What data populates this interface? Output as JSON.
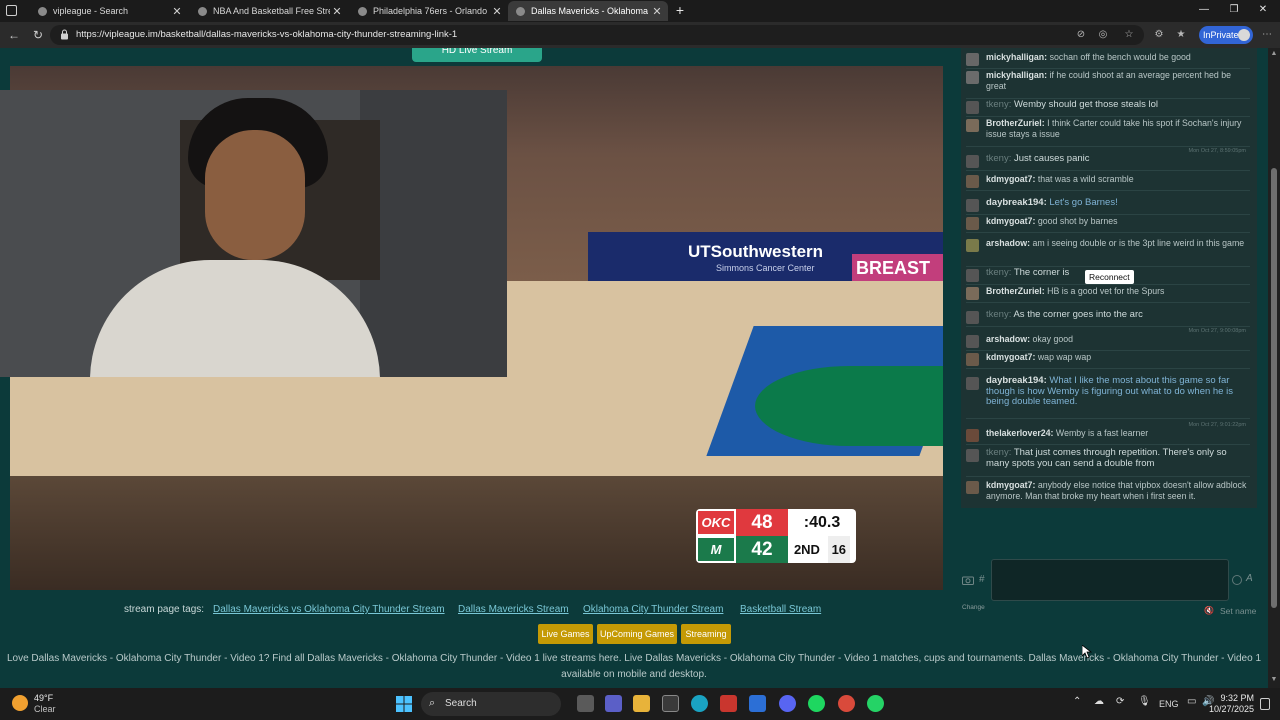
{
  "browser": {
    "tabs": [
      {
        "label": "vipleague - Search",
        "active": false
      },
      {
        "label": "NBA And Basketball Free Streams",
        "active": false
      },
      {
        "label": "Philadelphia 76ers - Orlando",
        "active": false
      },
      {
        "label": "Dallas Mavericks - Oklahoma",
        "active": true
      }
    ],
    "new_tab_label": "+",
    "url": "https://vipleague.im/basketball/dallas-mavericks-vs-oklahoma-city-thunder-streaming-link-1",
    "inprivate_label": "InPrivate"
  },
  "page": {
    "hd_button": "HD Live Stream",
    "video": {
      "banner_sponsor": "UTSouthwestern",
      "banner_sub": "Simmons Cancer Center",
      "banner_right": "BREAST HE",
      "scoreboard": {
        "team1_abbr": "OKC",
        "team1_score": "48",
        "clock": ":40.3",
        "team2_abbr": "M",
        "team2_score": "42",
        "period": "2ND",
        "shot_clock": "16"
      }
    },
    "tags_label": "stream page tags:",
    "tags": [
      "Dallas Mavericks vs Oklahoma City Thunder Stream",
      "Dallas Mavericks Stream",
      "Oklahoma City Thunder Stream",
      "Basketball Stream"
    ],
    "nav_buttons": [
      "Live Games",
      "UpComing Games",
      "Streaming"
    ],
    "footer_line1": "Love Dallas Mavericks - Oklahoma City Thunder - Video 1? Find all Dallas Mavericks - Oklahoma City Thunder - Video 1 live streams here. Live Dallas Mavericks - Oklahoma City Thunder - Video 1 matches, cups and tournaments. Dallas Mavericks - Oklahoma City Thunder - Video 1",
    "footer_line2": "available on mobile and desktop."
  },
  "chat": {
    "messages": [
      {
        "user": "mickyhalligan:",
        "text": "sochan off the bench would be good",
        "dim": false,
        "hl": false
      },
      {
        "user": "mickyhalligan:",
        "text": "if he could shoot at an average percent hed be great",
        "dim": false,
        "hl": false
      },
      {
        "user": "tkeny:",
        "text": "Wemby should get those steals lol",
        "dim": true,
        "hl": true
      },
      {
        "user": "BrotherZuriel:",
        "text": "I think Carter could take his spot if Sochan's injury issue stays a issue",
        "dim": false,
        "hl": false
      },
      {
        "user": "tkeny:",
        "text": "Just causes panic",
        "dim": true,
        "hl": true,
        "stamp": "Mon Oct 27, 8:59:05pm"
      },
      {
        "user": "kdmygoat7:",
        "text": "that was a wild scramble",
        "dim": false,
        "hl": false
      },
      {
        "user": "daybreak194:",
        "text": "Let's go Barnes!",
        "dim": false,
        "hl": true
      },
      {
        "user": "kdmygoat7:",
        "text": "good shot by barnes",
        "dim": false,
        "hl": false
      },
      {
        "user": "arshadow:",
        "text": "am i seeing double or is the 3pt line weird in this game",
        "dim": false,
        "hl": false
      },
      {
        "user": "tkeny:",
        "text": "The corner is",
        "dim": true,
        "hl": true
      },
      {
        "user": "BrotherZuriel:",
        "text": "HB is a good vet for the Spurs",
        "dim": false,
        "hl": false
      },
      {
        "user": "tkeny:",
        "text": "As the corner goes into the arc",
        "dim": true,
        "hl": true
      },
      {
        "user": "arshadow:",
        "text": "okay good",
        "dim": false,
        "hl": false,
        "stamp": "Mon Oct 27, 9:00:08pm"
      },
      {
        "user": "kdmygoat7:",
        "text": "wap wap wap",
        "dim": false,
        "hl": false
      },
      {
        "user": "daybreak194:",
        "text": "What I like the most about this game so far though is how Wemby is figuring out what to do when he is being double teamed.",
        "dim": false,
        "hl": true
      },
      {
        "user": "thelakerlover24:",
        "text": "Wemby is a fast learner",
        "dim": false,
        "hl": false,
        "stamp": "Mon Oct 27, 9:01:22pm"
      },
      {
        "user": "tkeny:",
        "text": "That just comes through repetition. There's only so many spots you can send a double from",
        "dim": true,
        "hl": true
      },
      {
        "user": "kdmygoat7:",
        "text": "anybody else notice that vipbox doesn't allow adblock anymore. Man that broke my heart when i first seen it.",
        "dim": false,
        "hl": false
      }
    ],
    "reconnect_label": "Reconnect",
    "hash_label": "#",
    "a_label": "A",
    "change_label": "Change",
    "set_name_label": "Set name"
  },
  "taskbar": {
    "temperature": "49°F",
    "weather": "Clear",
    "search_label": "Search",
    "lang": "ENG",
    "time": "9:32 PM",
    "date": "10/27/2025"
  },
  "colors": {
    "page_bg": "#0c3a3a",
    "chat_bg": "#1d3333",
    "accent_yellow": "#c59a05",
    "link": "#79c7d6",
    "okc_blue": "#e0393e",
    "mavs_green": "#1b7a4b"
  }
}
